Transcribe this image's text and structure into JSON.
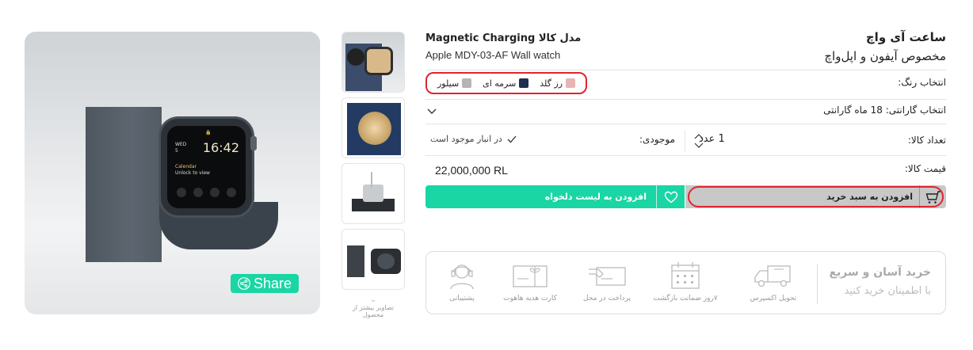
{
  "product": {
    "title": "ساعت آی واچ",
    "subtitle": "مخصوص آیفون و اپل‌واچ",
    "model_label": "مدل کالا Magnetic Charging",
    "model_value": "Apple MDY-03-AF Wall watch"
  },
  "colors": {
    "label": "انتخاب رنگ:",
    "options": [
      {
        "label": "رز گلد",
        "color": "#e8b4b4"
      },
      {
        "label": "سرمه ای",
        "color": "#1f3050"
      },
      {
        "label": "سیلور",
        "color": "#b5b5b5"
      }
    ]
  },
  "warranty": {
    "label": "انتخاب گارانتی:",
    "value": "18 ماه گارانتی"
  },
  "quantity": {
    "label": "تعداد کالا:",
    "value": "1 عدد",
    "stock_label": "موجودی:",
    "stock_status": "در انبار موجود است"
  },
  "price": {
    "label": "قیمت کالا:",
    "value": "22,000,000 RL"
  },
  "actions": {
    "add_to_cart": "افزودن به سبد خرید",
    "add_to_wishlist": "افزودن به لیست دلخواه"
  },
  "gallery": {
    "share_label": "Share",
    "more_images_label": "تصاویر بیشتر از محصول",
    "watch_day": "WED",
    "watch_date": "5",
    "watch_time": "16:42",
    "watch_cal_title": "Calendar",
    "watch_cal_text": "Unlock to view"
  },
  "features": {
    "heading": "خرید آسان و سریع",
    "subheading": "با اطمینان خرید کنید",
    "items": [
      {
        "label": "تحویل اکسپرس",
        "icon": "truck-icon"
      },
      {
        "label": "۷روز ضمانت بازگشت",
        "icon": "calendar-icon"
      },
      {
        "label": "پرداخت در محل",
        "icon": "card-payment-icon"
      },
      {
        "label": "کارت هدیه هاهوت",
        "icon": "gift-card-icon"
      },
      {
        "label": "پشتیبانی",
        "icon": "support-icon"
      }
    ]
  },
  "colors_theme": {
    "accent": "#19d6a4",
    "highlight": "#e0242f",
    "cart_button": "#c8c8c8"
  }
}
